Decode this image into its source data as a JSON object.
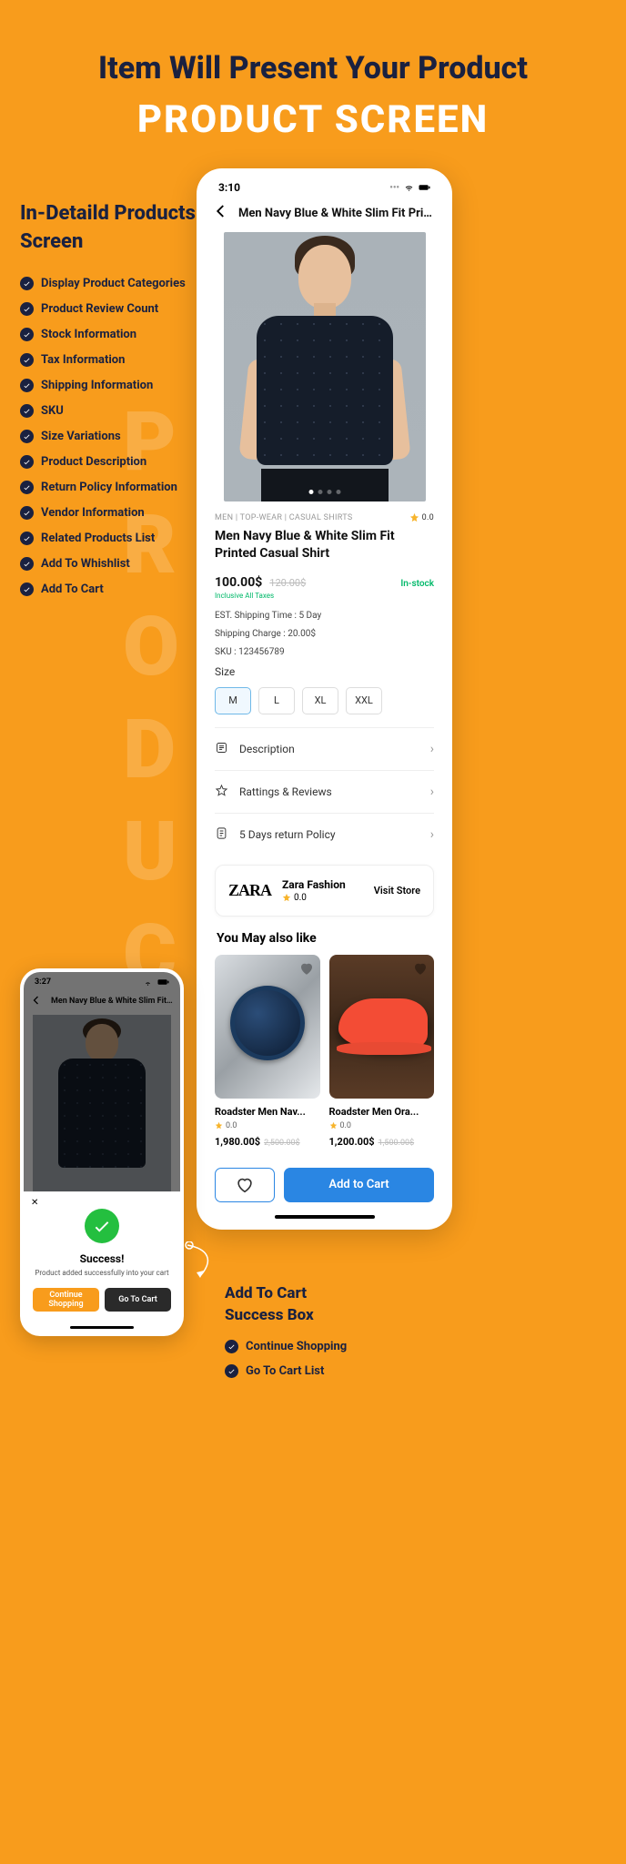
{
  "hero": {
    "line1": "Item Will Present Your Product",
    "line2": "PRODUCT SCREEN"
  },
  "vertical_word": "PRODUCT",
  "left": {
    "heading": "In-Detaild Products Screen",
    "items": [
      "Display Product Categories",
      "Product Review Count",
      "Stock Information",
      "Tax Information",
      "Shipping Information",
      "SKU",
      "Size Variations",
      "Product Description",
      "Return Policy Information",
      "Vendor Information",
      "Related Products List",
      "Add To Whishlist",
      "Add To Cart"
    ]
  },
  "status_time_main": "3:10",
  "status_time_popup": "3:27",
  "header_title": "Men Navy Blue & White Slim Fit Print...",
  "breadcrumb": "MEN | TOP-WEAR | CASUAL SHIRTS",
  "rating_top": "0.0",
  "product_title": "Men Navy Blue & White Slim Fit Printed Casual Shirt",
  "price": "100.00$",
  "orig_price": "120.00$",
  "stock": "In-stock",
  "tax_note": "Inclusive All Taxes",
  "ship_time": "EST. Shipping Time : 5 Day",
  "ship_charge": "Shipping Charge : 20.00$",
  "sku": "SKU : 123456789",
  "size_label": "Size",
  "sizes": [
    "M",
    "L",
    "XL",
    "XXL"
  ],
  "acc": {
    "desc": "Description",
    "reviews": "Rattings & Reviews",
    "return": "5 Days return Policy"
  },
  "vendor": {
    "logo": "ZARA",
    "name": "Zara Fashion",
    "rating": "0.0",
    "visit": "Visit Store"
  },
  "you_may": "You May also like",
  "related": [
    {
      "title": "Roadster Men Nav...",
      "rating": "0.0",
      "price": "1,980.00$",
      "old": "2,500.00$"
    },
    {
      "title": "Roadster Men Ora...",
      "rating": "0.0",
      "price": "1,200.00$",
      "old": "1,500.00$"
    }
  ],
  "add_to_cart": "Add to Cart",
  "popup": {
    "title": "Success!",
    "msg": "Product added successfully into your cart",
    "continue": "Continue Shopping",
    "go": "Go To Cart"
  },
  "bottom_right": {
    "heading1": "Add To Cart",
    "heading2": "Success Box",
    "items": [
      "Continue Shopping",
      "Go To Cart List"
    ]
  }
}
